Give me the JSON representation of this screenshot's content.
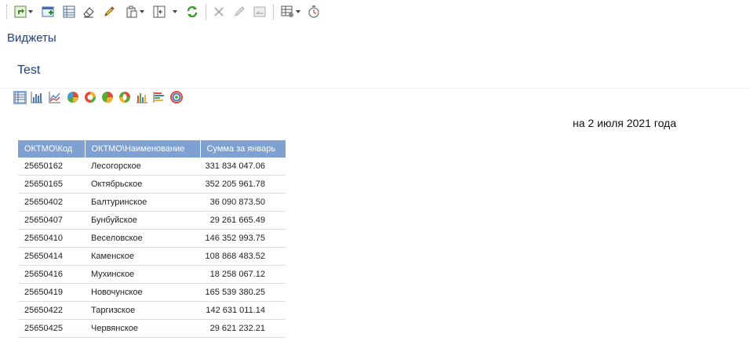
{
  "toolbar": {
    "icons": [
      "refresh-dropdown-icon",
      "add-widget-icon",
      "grid-view-icon",
      "eraser-icon",
      "pencil-icon",
      "paste-dropdown-icon",
      "layout-dropdown-icon",
      "sync-icon",
      "delete-icon",
      "edit-icon",
      "image-icon",
      "settings-dropdown-icon",
      "timer-icon"
    ]
  },
  "app": {
    "title": "Виджеты"
  },
  "widget": {
    "title": "Test"
  },
  "chart_types": [
    "table-chart-icon",
    "bar-chart-icon",
    "line-chart-icon",
    "pie-chart-icon",
    "donut-chart-icon",
    "pie3d-chart-icon",
    "ring-chart-icon",
    "column-chart-icon",
    "hbar-chart-icon",
    "radial-chart-icon"
  ],
  "report": {
    "date_label": "на 2 июля 2021 года"
  },
  "table": {
    "headers": [
      "ОКТМО\\Код",
      "ОКТМО\\Наименование",
      "Сумма за январь"
    ],
    "rows": [
      [
        "25650162",
        "Лесогорское",
        "331 834 047.06"
      ],
      [
        "25650165",
        "Октябрьское",
        "352 205 961.78"
      ],
      [
        "25650402",
        "Балтуринское",
        "36 090 873.50"
      ],
      [
        "25650407",
        "Бунбуйское",
        "29 261 665.49"
      ],
      [
        "25650410",
        "Веселовское",
        "146 352 993.75"
      ],
      [
        "25650414",
        "Каменское",
        "108 868 483.52"
      ],
      [
        "25650416",
        "Мухинское",
        "18 258 067.12"
      ],
      [
        "25650419",
        "Новочунское",
        "165 539 380.25"
      ],
      [
        "25650422",
        "Таргизское",
        "142 631 011.14"
      ],
      [
        "25650425",
        "Червянское",
        "29 621 232.21"
      ]
    ]
  },
  "colors": {
    "header_bg": "#7ea1d2",
    "title_text": "#1f3f7a"
  }
}
